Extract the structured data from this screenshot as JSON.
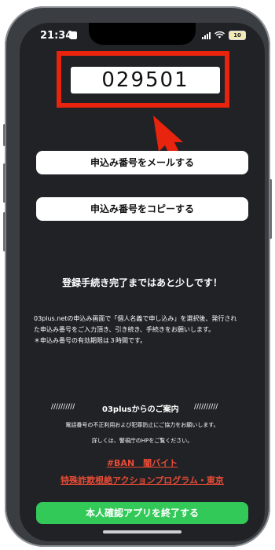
{
  "status": {
    "time": "21:34",
    "battery": "10"
  },
  "code": {
    "value": "029501"
  },
  "buttons": {
    "mail": "申込み番号をメールする",
    "copy": "申込み番号をコピーする",
    "exit": "本人確認アプリを終了する"
  },
  "messages": {
    "main": "登録手続き完了まではあと少しです！",
    "info_1": "03plus.netの申込み画面で「個人名義で申し込み」を選択後、発行され",
    "info_2": "た申込み番号をご入力頂き、引き続き、手続きをお願いします。",
    "info_3": "＊申込み番号の有効期限は３時間です。"
  },
  "notice": {
    "header_left": "//////////",
    "header_title": "03plusからのご案内",
    "header_right": "//////////",
    "line_1": "電話番号の不正利用および犯罪防止にご協力をお願いします。",
    "line_2": "詳しくは、警視庁のHPをご覧ください。"
  },
  "links": {
    "ban": "#BAN　闇バイト",
    "program": "特殊詐欺根絶アクションプログラム・東京"
  },
  "colors": {
    "highlight": "#e8230e",
    "exit_button": "#33c959",
    "link": "#e94b35"
  }
}
